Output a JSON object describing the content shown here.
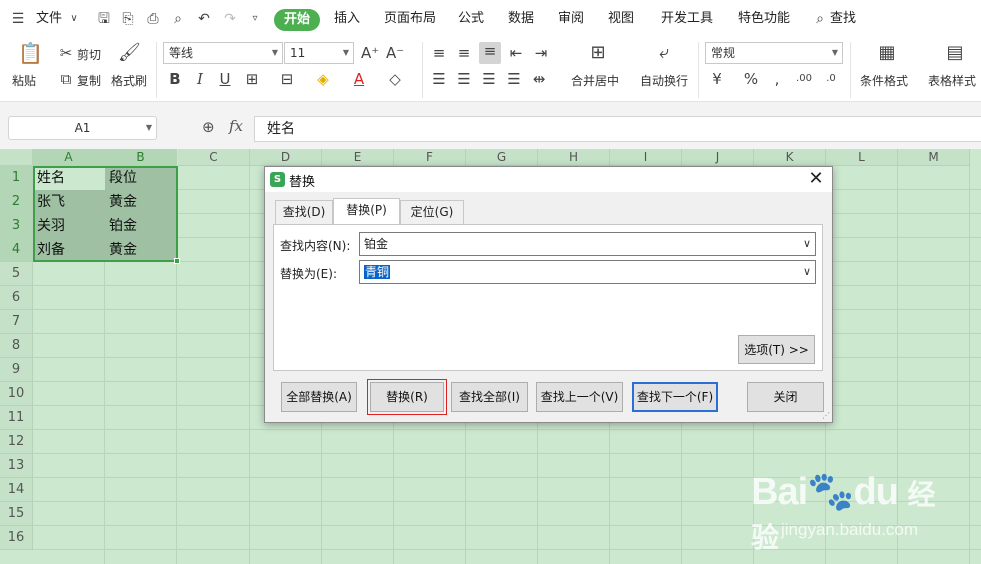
{
  "menubar": {
    "file": "文件",
    "start": "开始",
    "insert": "插入",
    "layout": "页面布局",
    "formula": "公式",
    "data": "数据",
    "review": "审阅",
    "view": "视图",
    "dev": "开发工具",
    "special": "特色功能",
    "search": "查找"
  },
  "ribbon": {
    "paste": "粘贴",
    "cut": "剪切",
    "copy": "复制",
    "format_painter": "格式刷",
    "font_name": "等线",
    "font_size": "11",
    "merge_center": "合并居中",
    "wrap_text": "自动换行",
    "number_format": "常规",
    "conditional_format": "条件格式",
    "table_style": "表格样式"
  },
  "formula_bar": {
    "name_box": "A1",
    "fx_label": "fx",
    "content": "姓名"
  },
  "sheet": {
    "columns": [
      "A",
      "B",
      "C",
      "D",
      "E",
      "F",
      "G",
      "H",
      "I",
      "J",
      "K",
      "L",
      "M"
    ],
    "rows": [
      "1",
      "2",
      "3",
      "4",
      "5",
      "6",
      "7",
      "8",
      "9",
      "10",
      "11",
      "12",
      "13",
      "14",
      "15",
      "16"
    ],
    "cells": [
      [
        "姓名",
        "段位"
      ],
      [
        "张飞",
        "黄金"
      ],
      [
        "关羽",
        "铂金"
      ],
      [
        "刘备",
        "黄金"
      ]
    ]
  },
  "dialog": {
    "title": "替换",
    "tabs": [
      "查找(D)",
      "替换(P)",
      "定位(G)"
    ],
    "find_label": "查找内容(N):",
    "find_value": "铂金",
    "replace_label": "替换为(E):",
    "replace_value": "青铜",
    "options_button": "选项(T) >>",
    "buttons": {
      "replace_all": "全部替换(A)",
      "replace": "替换(R)",
      "find_all": "查找全部(I)",
      "find_prev": "查找上一个(V)",
      "find_next": "查找下一个(F)",
      "close": "关闭"
    }
  },
  "watermark": {
    "brand": "Bai",
    "brand2": "du",
    "product": "经验",
    "url": "jingyan.baidu.com"
  }
}
